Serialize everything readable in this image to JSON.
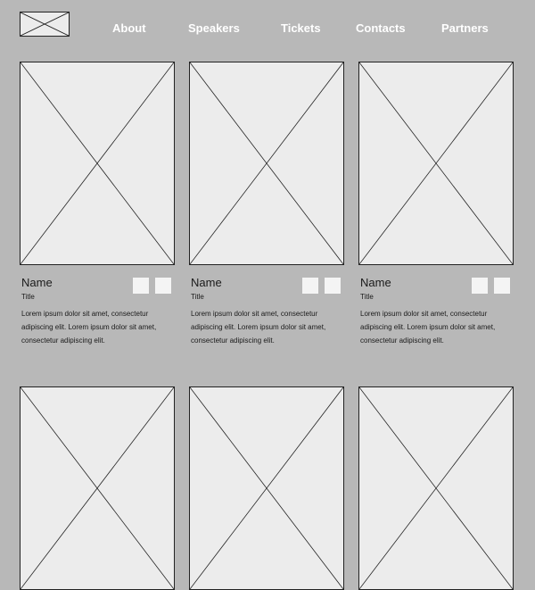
{
  "nav": {
    "links": [
      {
        "label": "About"
      },
      {
        "label": "Speakers"
      },
      {
        "label": "Tickets"
      },
      {
        "label": "Contacts"
      },
      {
        "label": "Partners"
      }
    ]
  },
  "speakers": [
    {
      "name": "Name",
      "title": "Title",
      "description": "Lorem ipsum dolor sit amet, consectetur adipiscing elit. Lorem ipsum dolor sit amet, consectetur adipiscing elit."
    },
    {
      "name": "Name",
      "title": "Title",
      "description": "Lorem ipsum dolor sit amet, consectetur adipiscing elit. Lorem ipsum dolor sit amet, consectetur adipiscing elit."
    },
    {
      "name": "Name",
      "title": "Title",
      "description": "Lorem ipsum dolor sit amet, consectetur adipiscing elit. Lorem ipsum dolor sit amet, consectetur adipiscing elit."
    }
  ],
  "colors": {
    "background": "#b8b8b8",
    "placeholder": "#ececec",
    "nav_text": "#ffffff",
    "body_text": "#1a1a1a"
  }
}
